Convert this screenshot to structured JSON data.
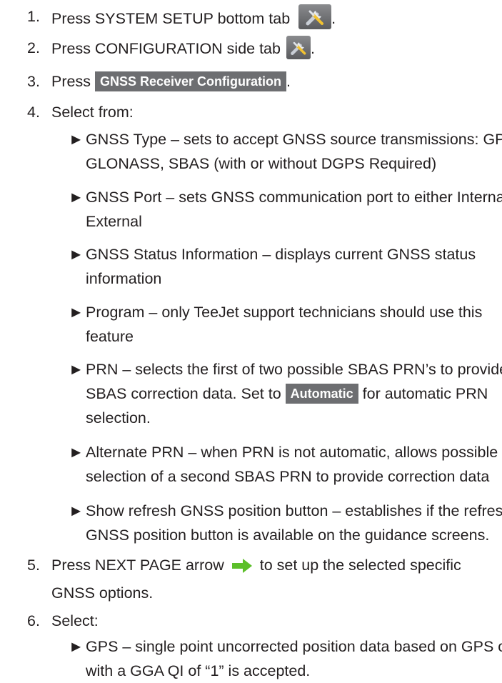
{
  "steps": [
    {
      "num": "1.",
      "before": "Press SYSTEM SETUP bottom tab",
      "icon": "wrench-screwdriver-icon",
      "after": "."
    },
    {
      "num": "2.",
      "before": "Press CONFIGURATION side tab",
      "icon": "wrench-screwdriver-icon",
      "after": "."
    },
    {
      "num": "3.",
      "before": "Press",
      "button": "GNSS Receiver Configuration",
      "after": "."
    },
    {
      "num": "4.",
      "text": "Select from:"
    },
    {
      "num": "5.",
      "before": "Press NEXT PAGE arrow",
      "icon": "green-arrow-right-icon",
      "after": "to set up the selected specific GNSS options."
    },
    {
      "num": "6.",
      "text": "Select:"
    }
  ],
  "select_from_items": [
    "GNSS Type – sets to accept GNSS source transmissions: GPS, GLONASS, SBAS (with or without DGPS Required)",
    "GNSS Port – sets GNSS communication port to either Internal or External",
    "GNSS Status Information – displays current GNSS status information",
    "Program – only TeeJet support technicians should use this feature",
    {
      "before": "PRN – selects the first of two possible SBAS PRN’s to provide SBAS correction data. Set to",
      "button": "Automatic",
      "after": "for automatic PRN selection."
    },
    "Alternate PRN – when PRN is not automatic, allows possible selection of a second SBAS PRN to provide correction data",
    "Show refresh GNSS position button – establishes if the refresh GNSS position button is available on the guidance screens."
  ],
  "select_items": [
    "GPS – single point uncorrected position data based on GPS only with a GGA QI of “1” is accepted."
  ],
  "bullet_glyph": "►",
  "colors": {
    "text": "#231f20",
    "button_bg": "#6d6e71",
    "arrow": "#5cbf2a"
  }
}
